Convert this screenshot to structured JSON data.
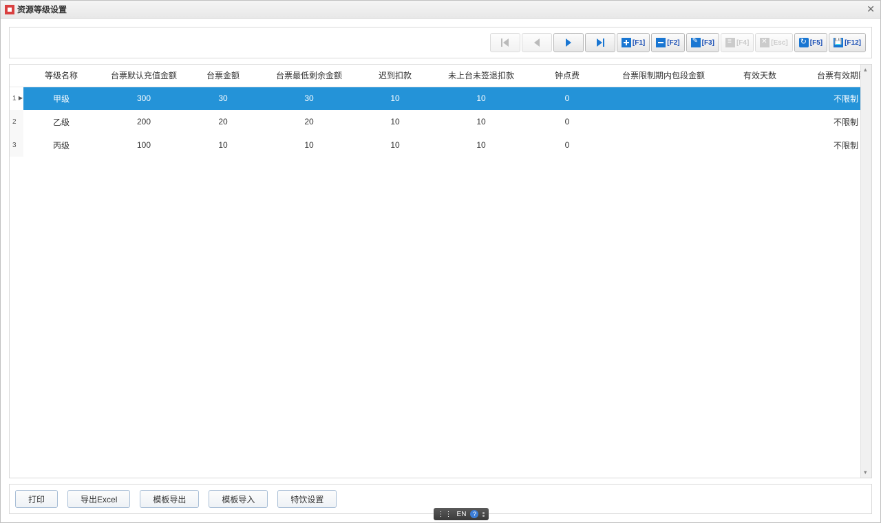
{
  "window": {
    "title": "资源等级设置"
  },
  "toolbar": {
    "fkeys": {
      "f1": "[F1]",
      "f2": "[F2]",
      "f3": "[F3]",
      "f4": "[F4]",
      "esc": "[Esc]",
      "f5": "[F5]",
      "f12": "[F12]"
    }
  },
  "table": {
    "columns": [
      "等级名称",
      "台票默认充值金额",
      "台票金额",
      "台票最低剩余金额",
      "迟到扣款",
      "未上台未签退扣款",
      "钟点费",
      "台票限制期内包段金额",
      "有效天数",
      "台票有效期限制"
    ],
    "rows": [
      {
        "n": "1",
        "cells": [
          "甲级",
          "300",
          "30",
          "30",
          "10",
          "10",
          "0",
          "",
          "",
          "不限制"
        ],
        "selected": true
      },
      {
        "n": "2",
        "cells": [
          "乙级",
          "200",
          "20",
          "20",
          "10",
          "10",
          "0",
          "",
          "",
          "不限制"
        ],
        "selected": false
      },
      {
        "n": "3",
        "cells": [
          "丙级",
          "100",
          "10",
          "10",
          "10",
          "10",
          "0",
          "",
          "",
          "不限制"
        ],
        "selected": false
      }
    ]
  },
  "footer": {
    "print": "打印",
    "export": "导出Excel",
    "tplout": "模板导出",
    "tplin": "模板导入",
    "drink": "特饮设置"
  },
  "ime": {
    "lang": "EN"
  }
}
